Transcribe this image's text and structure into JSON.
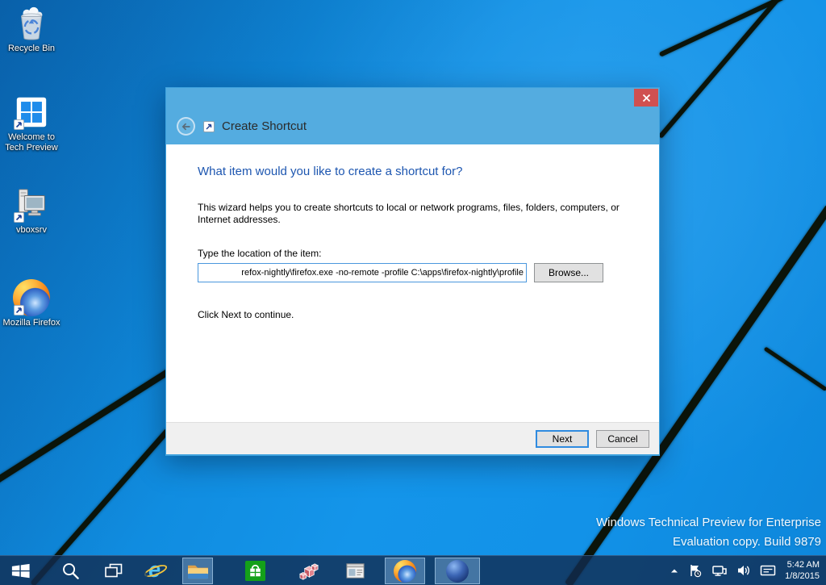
{
  "desktop": {
    "icons": [
      {
        "label": "Recycle Bin"
      },
      {
        "label": "Welcome to Tech Preview"
      },
      {
        "label": "vboxsrv"
      },
      {
        "label": "Mozilla Firefox"
      }
    ],
    "watermark_line1": "Windows Technical Preview for Enterprise",
    "watermark_line2": "Evaluation copy. Build 9879"
  },
  "dialog": {
    "title": "Create Shortcut",
    "heading": "What item would you like to create a shortcut for?",
    "description": "This wizard helps you to create shortcuts to local or network programs, files, folders, computers, or Internet addresses.",
    "location_label": "Type the location of the item:",
    "location_value": "refox-nightly\\firefox.exe -no-remote -profile C:\\apps\\firefox-nightly\\profile",
    "browse_label": "Browse...",
    "hint": "Click Next to continue.",
    "next_label": "Next",
    "cancel_label": "Cancel"
  },
  "taskbar": {
    "clock_time": "5:42 AM",
    "clock_date": "1/8/2015"
  },
  "colors": {
    "header_blue": "#54ace0",
    "close_red": "#d05050",
    "heading_blue": "#1d56b0",
    "wallpaper_blue": "#1292e8",
    "beam_dark": "#0b140a",
    "focus_blue": "#2f8be0"
  }
}
